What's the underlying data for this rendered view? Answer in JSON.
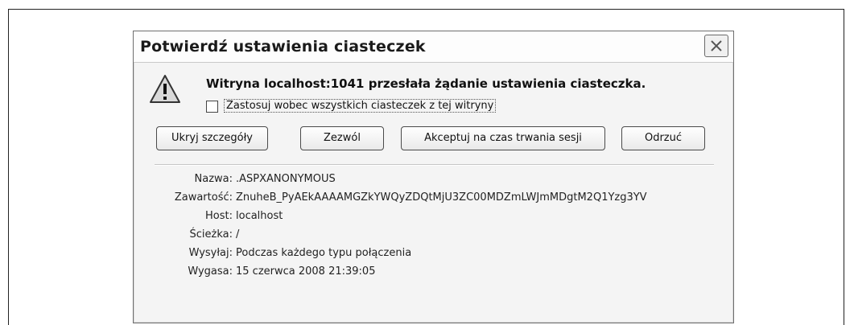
{
  "dialog": {
    "title": "Potwierdź ustawienia ciasteczek",
    "message": "Witryna localhost:1041 przesłała żądanie ustawienia ciasteczka.",
    "checkbox_label": "Zastosuj wobec wszystkich ciasteczek z tej witryny",
    "checkbox_checked": false
  },
  "buttons": {
    "hide_details": "Ukryj szczegóły",
    "allow": "Zezwól",
    "accept_session": "Akceptuj na czas trwania sesji",
    "deny": "Odrzuć"
  },
  "details": {
    "name_label": "Nazwa:",
    "name_value": ".ASPXANONYMOUS",
    "content_label": "Zawartość:",
    "content_value": "ZnuheB_PyAEkAAAAMGZkYWQyZDQtMjU3ZC00MDZmLWJmMDgtM2Q1Yzg3YV",
    "host_label": "Host:",
    "host_value": "localhost",
    "path_label": "Ścieżka:",
    "path_value": "/",
    "send_label": "Wysyłaj:",
    "send_value": "Podczas każdego typu połączenia",
    "expires_label": "Wygasa:",
    "expires_value": "15 czerwca 2008 21:39:05"
  }
}
